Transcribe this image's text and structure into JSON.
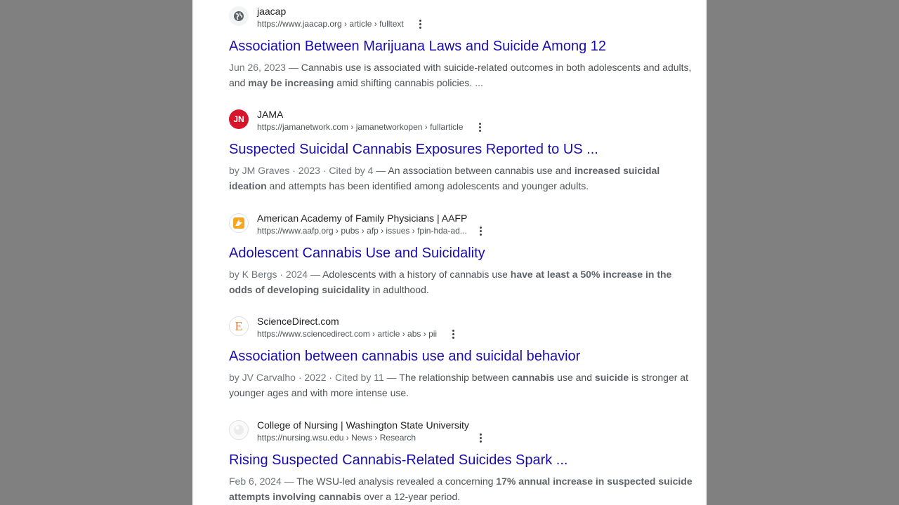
{
  "results": [
    {
      "site": "jaacap",
      "url": "https://www.jaacap.org › article › fulltext",
      "title": "Association Between Marijuana Laws and Suicide Among 12",
      "meta": "Jun 26, 2023 — ",
      "snippet": [
        {
          "t": "Cannabis use is associated with suicide-related outcomes in both adolescents and adults, and ",
          "b": false
        },
        {
          "t": "may be increasing",
          "b": true
        },
        {
          "t": " amid shifting cannabis policies. ...",
          "b": false
        }
      ],
      "favicon": "globe-icon"
    },
    {
      "site": "JAMA",
      "url": "https://jamanetwork.com › jamanetworkopen › fullarticle",
      "title": "Suspected Suicidal Cannabis Exposures Reported to US ...",
      "meta": "by JM Graves · 2023 · Cited by 4 — ",
      "snippet": [
        {
          "t": "An association between cannabis use and ",
          "b": false
        },
        {
          "t": "increased suicidal ideation",
          "b": true
        },
        {
          "t": " and attempts has been identified among adolescents and younger adults.",
          "b": false
        }
      ],
      "favicon": "jn-logo-icon",
      "favicon_text": "JN"
    },
    {
      "site": "American Academy of Family Physicians | AAFP",
      "url": "https://www.aafp.org › pubs › afp › issues › fpin-hda-ad...",
      "title": "Adolescent Cannabis Use and Suicidality",
      "meta": "by K Bergs · 2024 — ",
      "snippet": [
        {
          "t": "Adolescents with a history of cannabis use ",
          "b": false
        },
        {
          "t": "have at least a 50% increase in the odds of developing suicidality",
          "b": true
        },
        {
          "t": " in adulthood.",
          "b": false
        }
      ],
      "favicon": "aafp-logo-icon"
    },
    {
      "site": "ScienceDirect.com",
      "url": "https://www.sciencedirect.com › article › abs › pii",
      "title": "Association between cannabis use and suicidal behavior",
      "meta": "by JV Carvalho · 2022 · Cited by 11 — ",
      "snippet": [
        {
          "t": "The relationship between ",
          "b": false
        },
        {
          "t": "cannabis",
          "b": true
        },
        {
          "t": " use and ",
          "b": false
        },
        {
          "t": "suicide",
          "b": true
        },
        {
          "t": " is stronger at younger ages and with more intense use.",
          "b": false
        }
      ],
      "favicon": "elsevier-logo-icon",
      "favicon_text": "E"
    },
    {
      "site": "College of Nursing | Washington State University",
      "url": "https://nursing.wsu.edu › News › Research",
      "title": "Rising Suspected Cannabis-Related Suicides Spark ...",
      "meta": "Feb 6, 2024 — ",
      "snippet": [
        {
          "t": "The WSU-led analysis revealed a concerning ",
          "b": false
        },
        {
          "t": "17% annual increase in suspected suicide attempts involving cannabis",
          "b": true
        },
        {
          "t": " over a 12-year period.",
          "b": false
        }
      ],
      "favicon": "wsu-logo-icon"
    }
  ],
  "colors": {
    "title_link": "#1a0dab",
    "jama_red": "#d7152b",
    "elsevier_orange": "#f07b21"
  }
}
